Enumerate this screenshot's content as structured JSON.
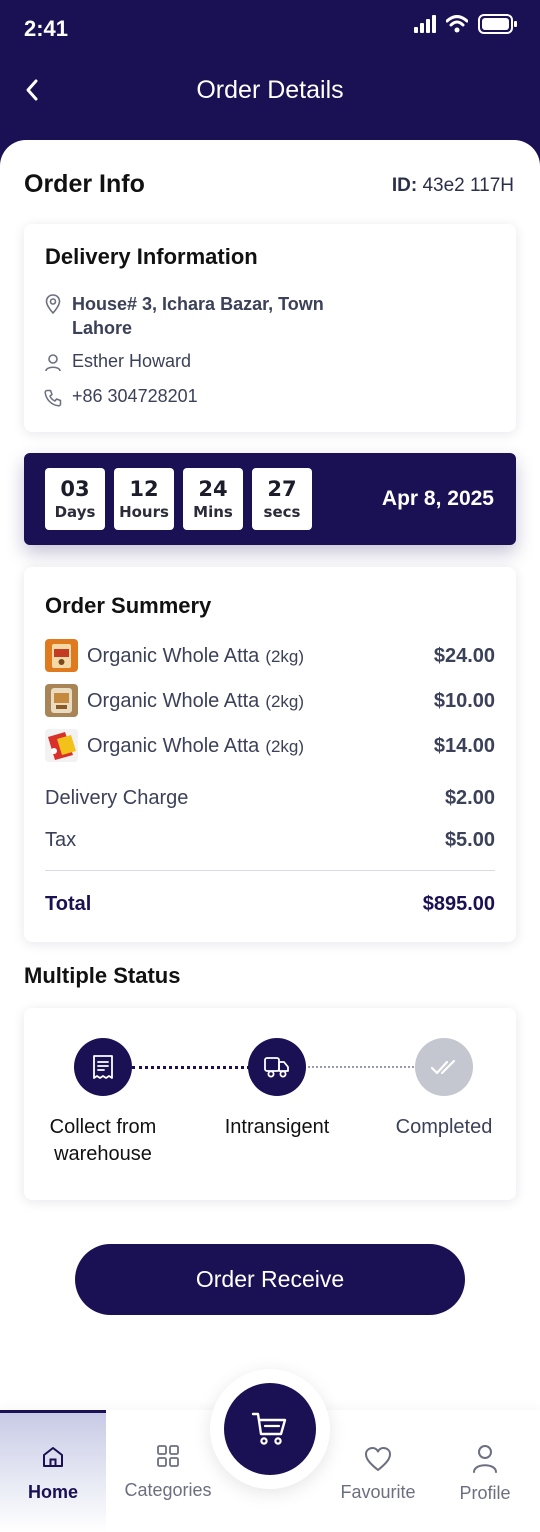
{
  "status_bar": {
    "time": "2:41"
  },
  "header": {
    "title": "Order Details"
  },
  "order_info": {
    "title": "Order Info",
    "id_label": "ID:",
    "id_value": "43e2 117H"
  },
  "delivery": {
    "title": "Delivery Information",
    "address_line1": "House# 3, Ichara Bazar, Town",
    "address_line2": "Lahore",
    "name": "Esther Howard",
    "phone": "+86 304728201"
  },
  "countdown": {
    "days": {
      "value": "03",
      "label": "Days"
    },
    "hours": {
      "value": "12",
      "label": "Hours"
    },
    "mins": {
      "value": "24",
      "label": "Mins"
    },
    "secs": {
      "value": "27",
      "label": "secs"
    },
    "date": "Apr 8, 2025"
  },
  "summary": {
    "title": "Order Summery",
    "items": [
      {
        "name": "Organic Whole Atta",
        "qty": "(2kg)",
        "price": "$24.00"
      },
      {
        "name": "Organic Whole Atta",
        "qty": "(2kg)",
        "price": "$10.00"
      },
      {
        "name": "Organic Whole Atta",
        "qty": "(2kg)",
        "price": "$14.00"
      }
    ],
    "delivery_charge_label": "Delivery Charge",
    "delivery_charge_value": "$2.00",
    "tax_label": "Tax",
    "tax_value": "$5.00",
    "total_label": "Total",
    "total_value": "$895.00"
  },
  "status": {
    "title": "Multiple Status",
    "steps": [
      {
        "label_line1": "Collect from",
        "label_line2": "warehouse",
        "state": "done"
      },
      {
        "label_line1": "Intransigent",
        "state": "done"
      },
      {
        "label_line1": "Completed",
        "state": "pending"
      }
    ]
  },
  "actions": {
    "receive_label": "Order Receive"
  },
  "nav": {
    "items": [
      {
        "label": "Home",
        "icon": "home-icon",
        "active": true
      },
      {
        "label": "Categories",
        "icon": "grid-icon"
      },
      {
        "label": "Favourite",
        "icon": "heart-icon"
      },
      {
        "label": "Profile",
        "icon": "user-icon"
      }
    ],
    "cart_icon": "cart-icon"
  },
  "colors": {
    "primary": "#1a1054",
    "text_muted": "#3b4158",
    "step_pending": "#c4c6d0"
  }
}
